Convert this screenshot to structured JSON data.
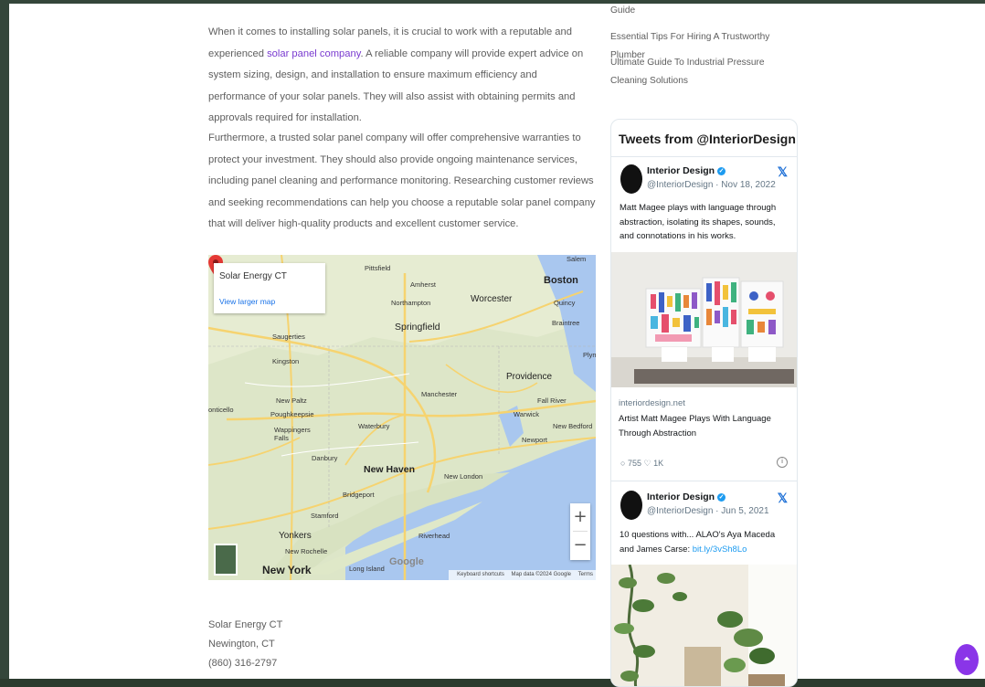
{
  "article": {
    "p1_before_link": "When it comes to installing solar panels, it is crucial to work with a reputable and experienced ",
    "p1_link": "solar panel company",
    "p1_after_link": ". A reliable company will provide expert advice on system sizing, design, and installation to ensure maximum efficiency and performance of your solar panels. They will also assist with obtaining permits and approvals required for installation.",
    "p2": "Furthermore, a trusted solar panel company will offer comprehensive warranties to protect your investment. They should also provide ongoing maintenance services, including panel cleaning and performance monitoring. Researching customer reviews and seeking recommendations can help you choose a reputable solar panel company that will deliver high-quality products and excellent customer service."
  },
  "map": {
    "place_name": "Solar Energy CT",
    "larger_map_link": "View larger map",
    "zoom_in": "+",
    "zoom_out": "−",
    "google": "Google",
    "footer_shortcuts": "Keyboard shortcuts",
    "footer_data": "Map data ©2024 Google",
    "footer_terms": "Terms",
    "labels": {
      "pittsfield": "Pittsfield",
      "amherst": "Amherst",
      "northampton": "Northampton",
      "boston": "Boston",
      "worcester": "Worcester",
      "quincy": "Quincy",
      "braintree": "Braintree",
      "saugerties": "Saugerties",
      "springfield": "Springfield",
      "kingston": "Kingston",
      "providence": "Providence",
      "plym": "Plym",
      "new_paltz": "New Paltz",
      "poughkeepsie": "Poughkeepsie",
      "manchester": "Manchester",
      "fall_river": "Fall River",
      "warwick": "Warwick",
      "new_bedford": "New Bedford",
      "onticello": "onticello",
      "wappingers": "Wappingers Falls",
      "waterbury": "Waterbury",
      "newport": "Newport",
      "danbury": "Danbury",
      "new_haven": "New Haven",
      "new_london": "New London",
      "bridgeport": "Bridgeport",
      "stamford": "Stamford",
      "yonkers": "Yonkers",
      "new_rochelle": "New Rochelle",
      "riverhead": "Riverhead",
      "new_york": "New York",
      "long_island": "Long Island",
      "salem": "Salem"
    }
  },
  "address": {
    "line1": "Solar Energy CT",
    "line2": "Newington, CT",
    "line3": "(860) 316-2797"
  },
  "sidebar": {
    "recent": [
      "Guide",
      "Essential Tips For Hiring A Trustworthy Plumber",
      "Ultimate Guide To Industrial Pressure Cleaning Solutions"
    ]
  },
  "twitter": {
    "header": "Tweets from @InteriorDesign",
    "tweets": [
      {
        "name": "Interior Design",
        "handle": "@InteriorDesign · Nov 18, 2022",
        "text": "Matt Magee plays with language through abstraction, isolating its shapes, sounds, and connotations in his works.",
        "domain": "interiordesign.net",
        "link_title": "Artist Matt Magee Plays With Language Through Abstraction",
        "replies": "755",
        "likes": "1K"
      },
      {
        "name": "Interior Design",
        "handle": "@InteriorDesign · Jun 5, 2021",
        "text_before": "10 questions with... ALAO's Aya Maceda and James Carse: ",
        "text_link": "bit.ly/3vSh8Lo"
      }
    ]
  },
  "colors": {
    "accent": "#7a3bd0",
    "twitter_blue": "#1d9bf0",
    "back_to_top": "#8a35e8"
  }
}
